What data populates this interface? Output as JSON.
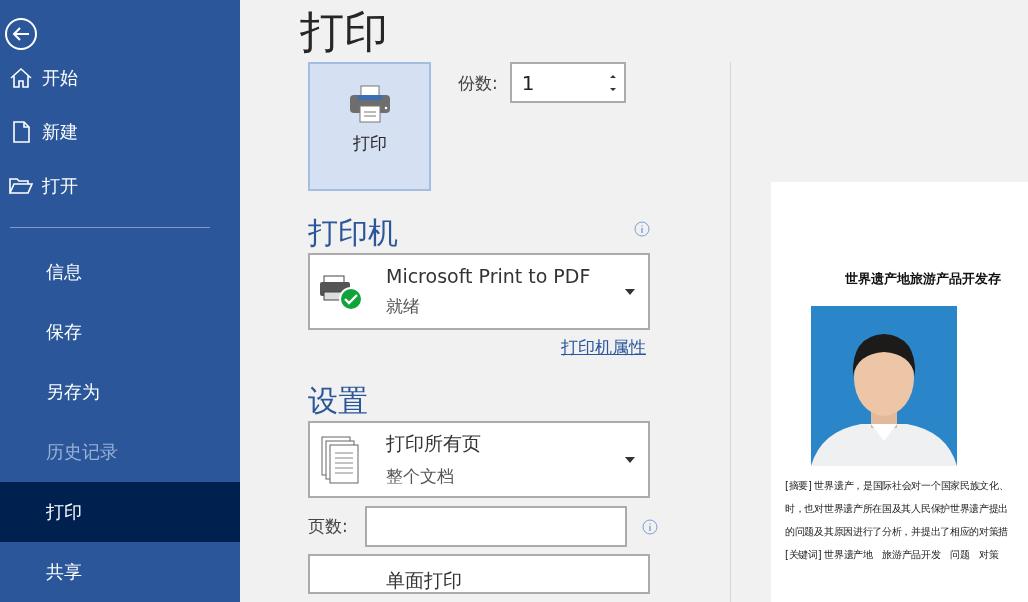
{
  "sidebar": {
    "nav": [
      {
        "label": "开始",
        "selected": false,
        "disabled": false
      },
      {
        "label": "新建",
        "selected": false,
        "disabled": false
      },
      {
        "label": "打开",
        "selected": false,
        "disabled": false
      }
    ],
    "items": [
      {
        "label": "信息",
        "selected": false,
        "disabled": false
      },
      {
        "label": "保存",
        "selected": false,
        "disabled": false
      },
      {
        "label": "另存为",
        "selected": false,
        "disabled": false
      },
      {
        "label": "历史记录",
        "selected": false,
        "disabled": true
      },
      {
        "label": "打印",
        "selected": true,
        "disabled": false
      },
      {
        "label": "共享",
        "selected": false,
        "disabled": false
      }
    ]
  },
  "page_title": "打印",
  "print_button": {
    "label": "打印"
  },
  "copies": {
    "label": "份数:",
    "value": "1"
  },
  "printer": {
    "heading": "打印机",
    "name": "Microsoft Print to PDF",
    "status": "就绪",
    "ready": true,
    "properties_link": "打印机属性"
  },
  "settings": {
    "heading": "设置",
    "options": [
      {
        "title": "打印所有页",
        "subtitle": "整个文档"
      }
    ],
    "pages_label": "页数:",
    "next_option": "单面打印"
  },
  "preview": {
    "title": "世界遗产地旅游产品开发存",
    "lines": [
      "[摘要] 世界遗产，是国际社会对一个国家民族文化、",
      "时，也对世界遗产所在国及其人民保护世界遗产提出",
      "的问题及其原因进行了分析，并提出了相应的对策措",
      "[关键词] 世界遗产地　旅游产品开发　问题　对策"
    ]
  }
}
